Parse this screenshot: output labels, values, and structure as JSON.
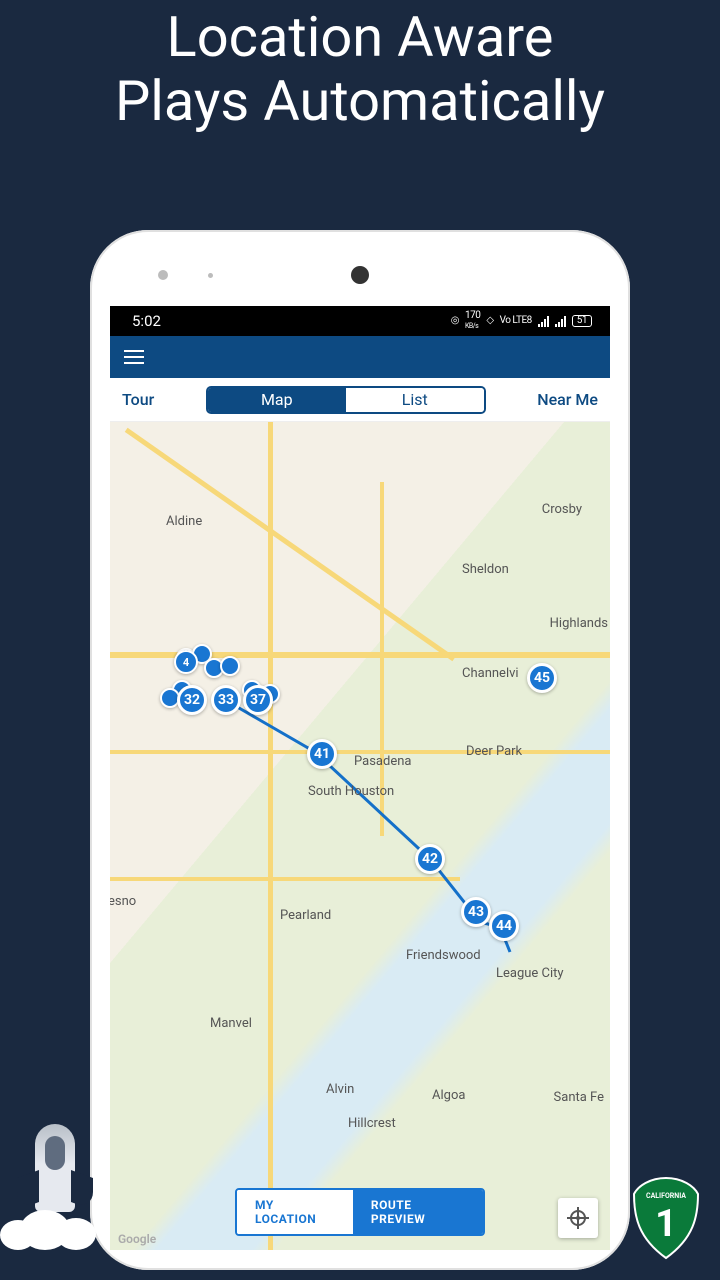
{
  "headline_line1": "Location Aware",
  "headline_line2": "Plays Automatically",
  "statusbar": {
    "time": "5:02",
    "data_rate": "170",
    "data_unit": "KB/s",
    "net": "Vo LTE8",
    "battery": "51"
  },
  "tabs": {
    "left": "Tour",
    "seg_map": "Map",
    "seg_list": "List",
    "right": "Near Me"
  },
  "bottom": {
    "my_location": "MY LOCATION",
    "route_preview": "ROUTE PREVIEW"
  },
  "map_labels": {
    "aldine": "Aldine",
    "crosby": "Crosby",
    "sheldon": "Sheldon",
    "highlands": "Highlands",
    "channelvi": "Channelvi",
    "pasadena": "Pasadena",
    "deer_park": "Deer Park",
    "south_houston": "South Houston",
    "pearland": "Pearland",
    "friendswood": "Friendswood",
    "league_city": "League City",
    "manvel": "Manvel",
    "alvin": "Alvin",
    "algoa": "Algoa",
    "hillcrest": "Hillcrest",
    "santa_fe": "Santa Fe",
    "esno": "esno",
    "google": "Google"
  },
  "pins": {
    "p4": "4",
    "p32": "32",
    "p33": "33",
    "p37": "37",
    "p41": "41",
    "p42": "42",
    "p43": "43",
    "p44": "44",
    "p45": "45"
  },
  "shield": {
    "state": "CALIFORNIA",
    "num": "1"
  }
}
